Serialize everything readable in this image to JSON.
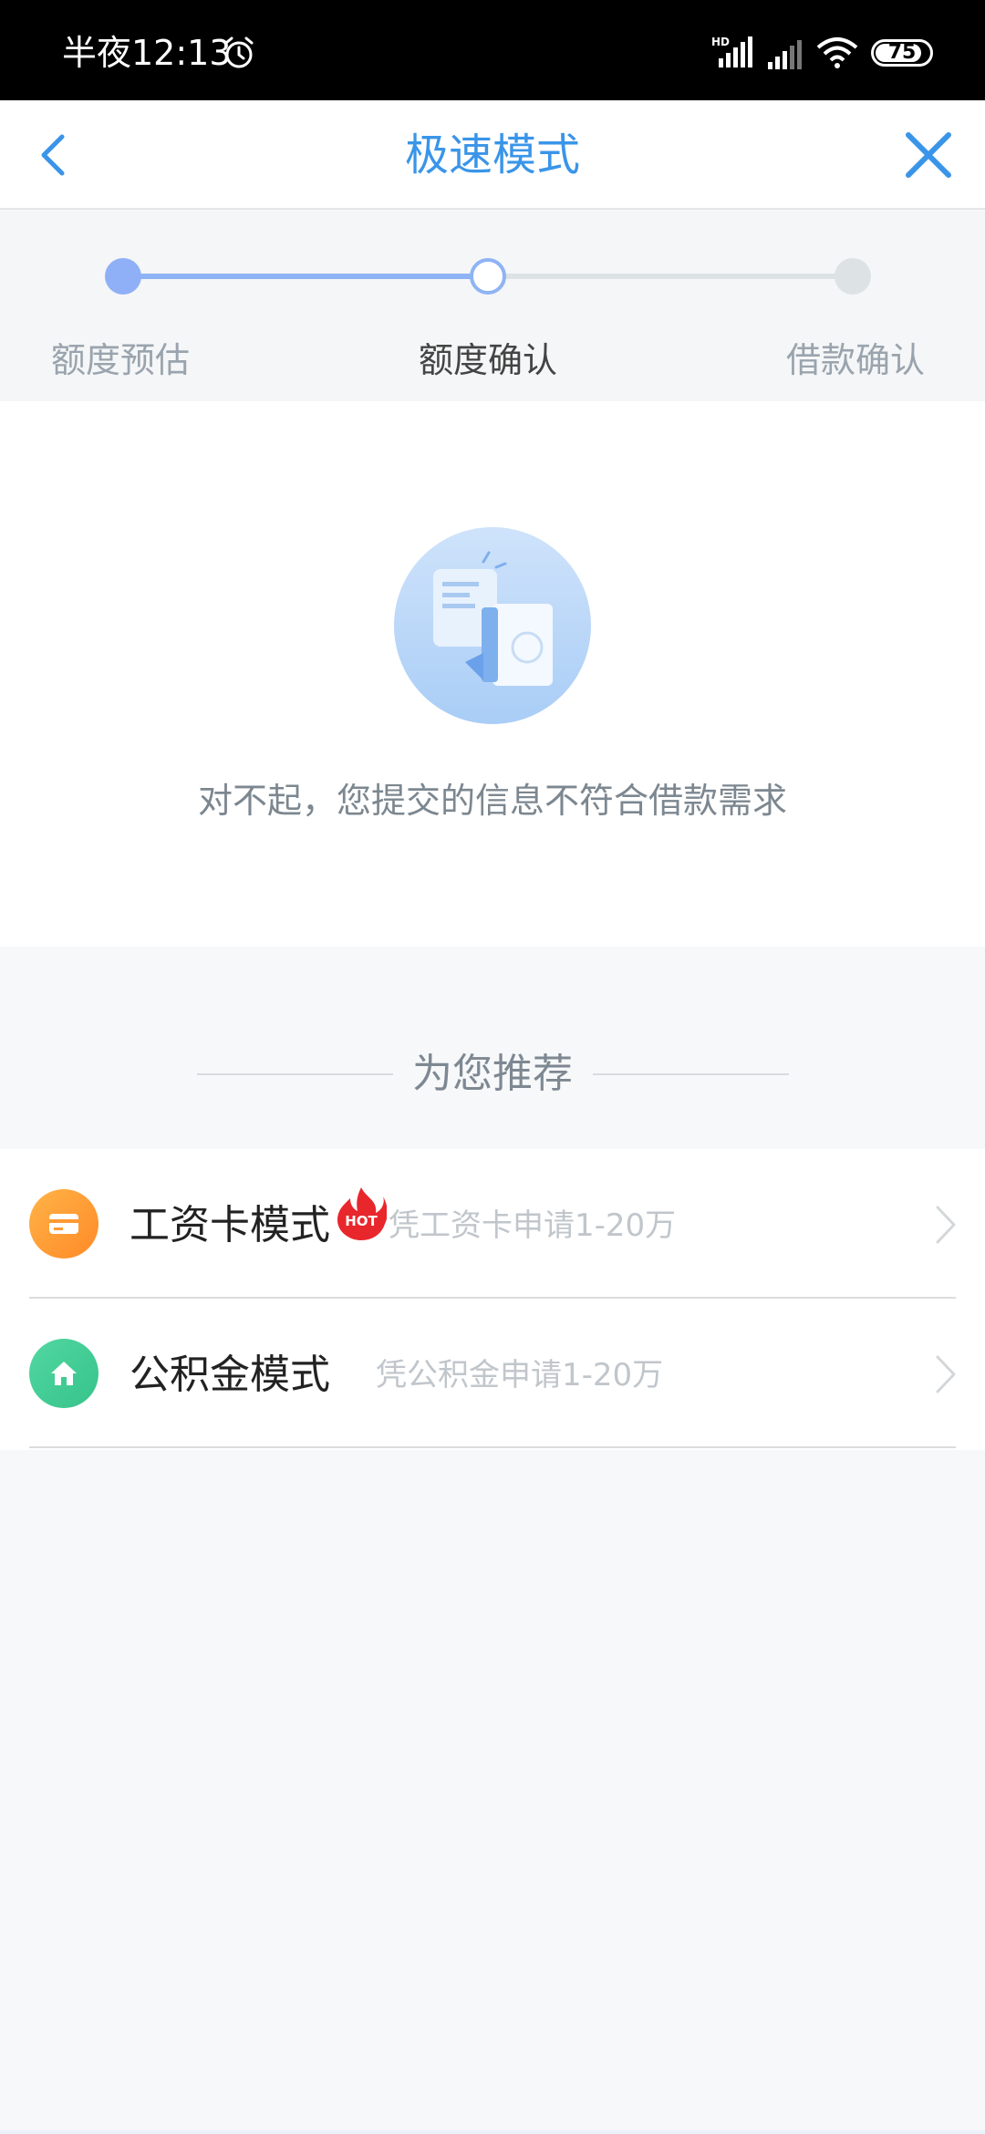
{
  "status_bar": {
    "time": "半夜12:13",
    "battery": "75"
  },
  "header": {
    "title": "极速模式"
  },
  "steps": [
    {
      "label": "额度预估",
      "state": "done"
    },
    {
      "label": "额度确认",
      "state": "current"
    },
    {
      "label": "借款确认",
      "state": "todo"
    }
  ],
  "result": {
    "message": "对不起，您提交的信息不符合借款需求"
  },
  "recommend": {
    "title": "为您推荐",
    "items": [
      {
        "title": "工资卡模式",
        "badge": "HOT",
        "description": "凭工资卡申请1-20万",
        "icon": "card-icon",
        "color": "#ff9a34"
      },
      {
        "title": "公积金模式",
        "description": "凭公积金申请1-20万",
        "icon": "home-icon",
        "color": "#3ecb91"
      }
    ]
  },
  "colors": {
    "accent": "#3a95e8",
    "step_done": "#8fb0f6",
    "step_todo": "#dde2e4"
  }
}
